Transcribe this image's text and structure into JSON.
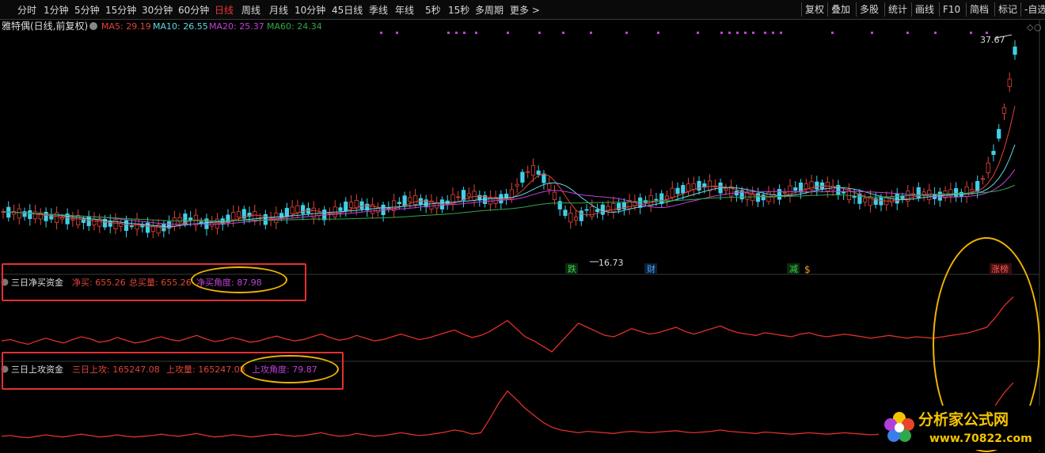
{
  "toolbar": {
    "periods": [
      "分时",
      "1分钟",
      "5分钟",
      "15分钟",
      "30分钟",
      "60分钟",
      "日线",
      "周线",
      "月线",
      "10分钟",
      "45日线",
      "季线",
      "年线",
      "5秒",
      "15秒",
      "多周期",
      "更多 >"
    ],
    "active_period": "日线",
    "right_buttons": [
      "复权",
      "叠加",
      "多股",
      "统计",
      "画线",
      "F10",
      "简档",
      "标记",
      "-自选"
    ]
  },
  "main_panel": {
    "stock_title": "雅特偶(日线,前复权)",
    "ma": [
      {
        "label": "MA5: 29.19",
        "color": "#e0443a"
      },
      {
        "label": "MA10: 26.55",
        "color": "#5fd8e8"
      },
      {
        "label": "MA20: 25.37",
        "color": "#c040d8"
      },
      {
        "label": "MA60: 24.34",
        "color": "#2fa84a"
      }
    ],
    "high_label": "37.67",
    "low_label": "16.73",
    "events": [
      {
        "text": "跌",
        "color": "#3ccf4e"
      },
      {
        "text": "财",
        "color": "#4aa8ff"
      },
      {
        "text": "减",
        "color": "#3ccf4e"
      },
      {
        "text": "$",
        "color": "#f0a020"
      },
      {
        "text": "涨榜",
        "color": "#ff5a5a"
      }
    ]
  },
  "indicator1": {
    "name": "三日净买资金",
    "values": [
      {
        "label": "净买: 655.26",
        "color": "#e0443a"
      },
      {
        "label": "总买量: 655.26",
        "color": "#e0443a"
      },
      {
        "label": "净买角度: 87.98",
        "color": "#c040d8"
      }
    ]
  },
  "indicator2": {
    "name": "三日上攻资金",
    "values": [
      {
        "label": "三日上攻: 165247.08",
        "color": "#e0443a"
      },
      {
        "label": "上攻量: 165247.08",
        "color": "#e0443a"
      },
      {
        "label": "上攻角度: 79.87",
        "color": "#c040d8"
      }
    ]
  },
  "watermark": {
    "title": "分析家公式网",
    "url": "www.70822.com"
  },
  "colors": {
    "up": "#e0443a",
    "down": "#40d0e8",
    "ma5": "#e0443a",
    "ma10": "#5fd8e8",
    "ma20": "#c040d8",
    "ma60": "#2fa84a",
    "line": "#e0302a"
  },
  "chart_data": {
    "type": "line",
    "title": "雅特偶(日线,前复权)",
    "series": [
      {
        "name": "净买",
        "values": [
          0.3,
          0.32,
          0.28,
          0.25,
          0.3,
          0.34,
          0.3,
          0.27,
          0.32,
          0.36,
          0.33,
          0.28,
          0.3,
          0.35,
          0.31,
          0.27,
          0.29,
          0.33,
          0.36,
          0.32,
          0.3,
          0.34,
          0.38,
          0.33,
          0.29,
          0.31,
          0.35,
          0.32,
          0.28,
          0.3,
          0.34,
          0.37,
          0.33,
          0.3,
          0.32,
          0.36,
          0.4,
          0.35,
          0.31,
          0.33,
          0.38,
          0.34,
          0.3,
          0.32,
          0.36,
          0.4,
          0.36,
          0.32,
          0.34,
          0.38,
          0.42,
          0.46,
          0.4,
          0.35,
          0.38,
          0.44,
          0.52,
          0.6,
          0.48,
          0.36,
          0.3,
          0.22,
          0.14,
          0.28,
          0.42,
          0.56,
          0.5,
          0.44,
          0.38,
          0.36,
          0.42,
          0.48,
          0.44,
          0.4,
          0.42,
          0.46,
          0.5,
          0.44,
          0.4,
          0.44,
          0.48,
          0.52,
          0.46,
          0.42,
          0.4,
          0.38,
          0.42,
          0.4,
          0.38,
          0.36,
          0.4,
          0.42,
          0.38,
          0.36,
          0.38,
          0.4,
          0.38,
          0.36,
          0.34,
          0.36,
          0.38,
          0.36,
          0.34,
          0.36,
          0.35,
          0.34,
          0.36,
          0.38,
          0.4,
          0.42,
          0.46,
          0.5,
          0.65,
          0.82,
          0.95
        ]
      },
      {
        "name": "三日上攻",
        "values": [
          0.15,
          0.16,
          0.14,
          0.13,
          0.15,
          0.17,
          0.15,
          0.14,
          0.16,
          0.18,
          0.16,
          0.14,
          0.15,
          0.17,
          0.15,
          0.14,
          0.15,
          0.16,
          0.18,
          0.16,
          0.15,
          0.17,
          0.19,
          0.16,
          0.14,
          0.15,
          0.17,
          0.16,
          0.14,
          0.15,
          0.17,
          0.18,
          0.16,
          0.15,
          0.16,
          0.18,
          0.2,
          0.17,
          0.15,
          0.16,
          0.19,
          0.17,
          0.15,
          0.16,
          0.18,
          0.2,
          0.18,
          0.16,
          0.17,
          0.19,
          0.21,
          0.24,
          0.22,
          0.18,
          0.2,
          0.4,
          0.62,
          0.8,
          0.68,
          0.55,
          0.45,
          0.35,
          0.28,
          0.24,
          0.22,
          0.2,
          0.22,
          0.21,
          0.2,
          0.19,
          0.21,
          0.22,
          0.21,
          0.2,
          0.21,
          0.22,
          0.23,
          0.21,
          0.2,
          0.21,
          0.22,
          0.24,
          0.22,
          0.21,
          0.2,
          0.19,
          0.21,
          0.2,
          0.19,
          0.18,
          0.19,
          0.2,
          0.19,
          0.18,
          0.19,
          0.2,
          0.19,
          0.18,
          0.17,
          0.18,
          0.19,
          0.18,
          0.17,
          0.18,
          0.18,
          0.17,
          0.18,
          0.19,
          0.2,
          0.22,
          0.28,
          0.4,
          0.6,
          0.78,
          0.92
        ]
      }
    ]
  }
}
